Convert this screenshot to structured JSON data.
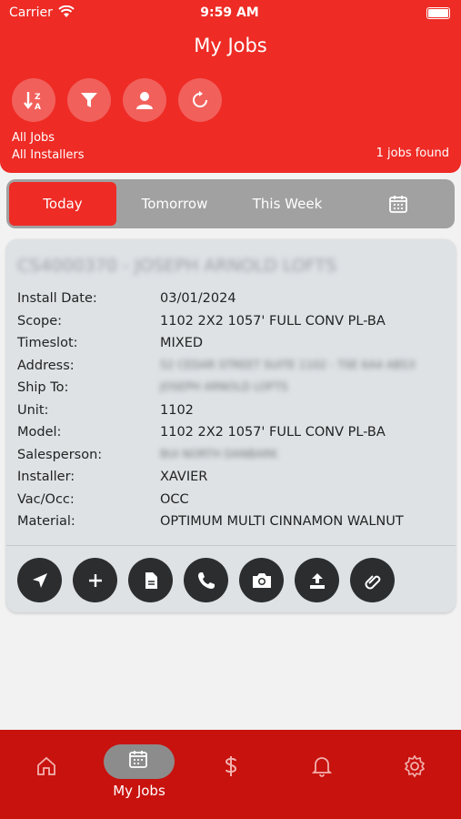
{
  "status_bar": {
    "carrier": "Carrier",
    "time": "9:59 AM"
  },
  "header": {
    "title": "My Jobs",
    "buttons": [
      {
        "icon": "sort-az-icon"
      },
      {
        "icon": "filter-icon"
      },
      {
        "icon": "user-icon"
      },
      {
        "icon": "refresh-icon"
      }
    ],
    "filter_jobs": "All Jobs",
    "filter_installers": "All Installers",
    "jobs_found": "1 jobs found"
  },
  "date_tabs": {
    "items": [
      "Today",
      "Tomorrow",
      "This Week"
    ],
    "active": "Today",
    "calendar_icon": "calendar-icon"
  },
  "job_card": {
    "title": "CS4000370 - JOSEPH ARNOLD LOFTS",
    "fields": [
      {
        "label": "Install Date:",
        "value": "03/01/2024"
      },
      {
        "label": "Scope:",
        "value": "1102 2X2 1057' FULL CONV PL-BA"
      },
      {
        "label": "Timeslot:",
        "value": "MIXED"
      },
      {
        "label": "Address:",
        "value": "52 CEDAR STREET SUITE 1102 - T0E 6A4 AB53"
      },
      {
        "label": "Ship To:",
        "value": "JOSEPH ARNOLD LOFTS"
      },
      {
        "label": "Unit:",
        "value": "1102"
      },
      {
        "label": "Model:",
        "value": "1102 2X2 1057' FULL CONV PL-BA"
      },
      {
        "label": "Salesperson:",
        "value": "BUI NORTH DANBARK"
      },
      {
        "label": "Installer:",
        "value": "XAVIER"
      },
      {
        "label": "Vac/Occ:",
        "value": "OCC"
      },
      {
        "label": "Material:",
        "value": "OPTIMUM MULTI CINNAMON WALNUT"
      }
    ],
    "actions": [
      "navigate-icon",
      "add-icon",
      "document-icon",
      "phone-icon",
      "camera-icon",
      "upload-icon",
      "attachment-icon"
    ]
  },
  "tab_bar": {
    "items": [
      {
        "icon": "home-icon",
        "label": ""
      },
      {
        "icon": "calendar-icon",
        "label": "My Jobs"
      },
      {
        "icon": "dollar-icon",
        "label": ""
      },
      {
        "icon": "bell-icon",
        "label": ""
      },
      {
        "icon": "gear-icon",
        "label": ""
      }
    ],
    "active": "My Jobs"
  },
  "colors": {
    "brand_red": "#ee2b25",
    "tabbar_red": "#c8120e",
    "card_bg": "#dee2e5",
    "action_dark": "#2b2d2f"
  }
}
